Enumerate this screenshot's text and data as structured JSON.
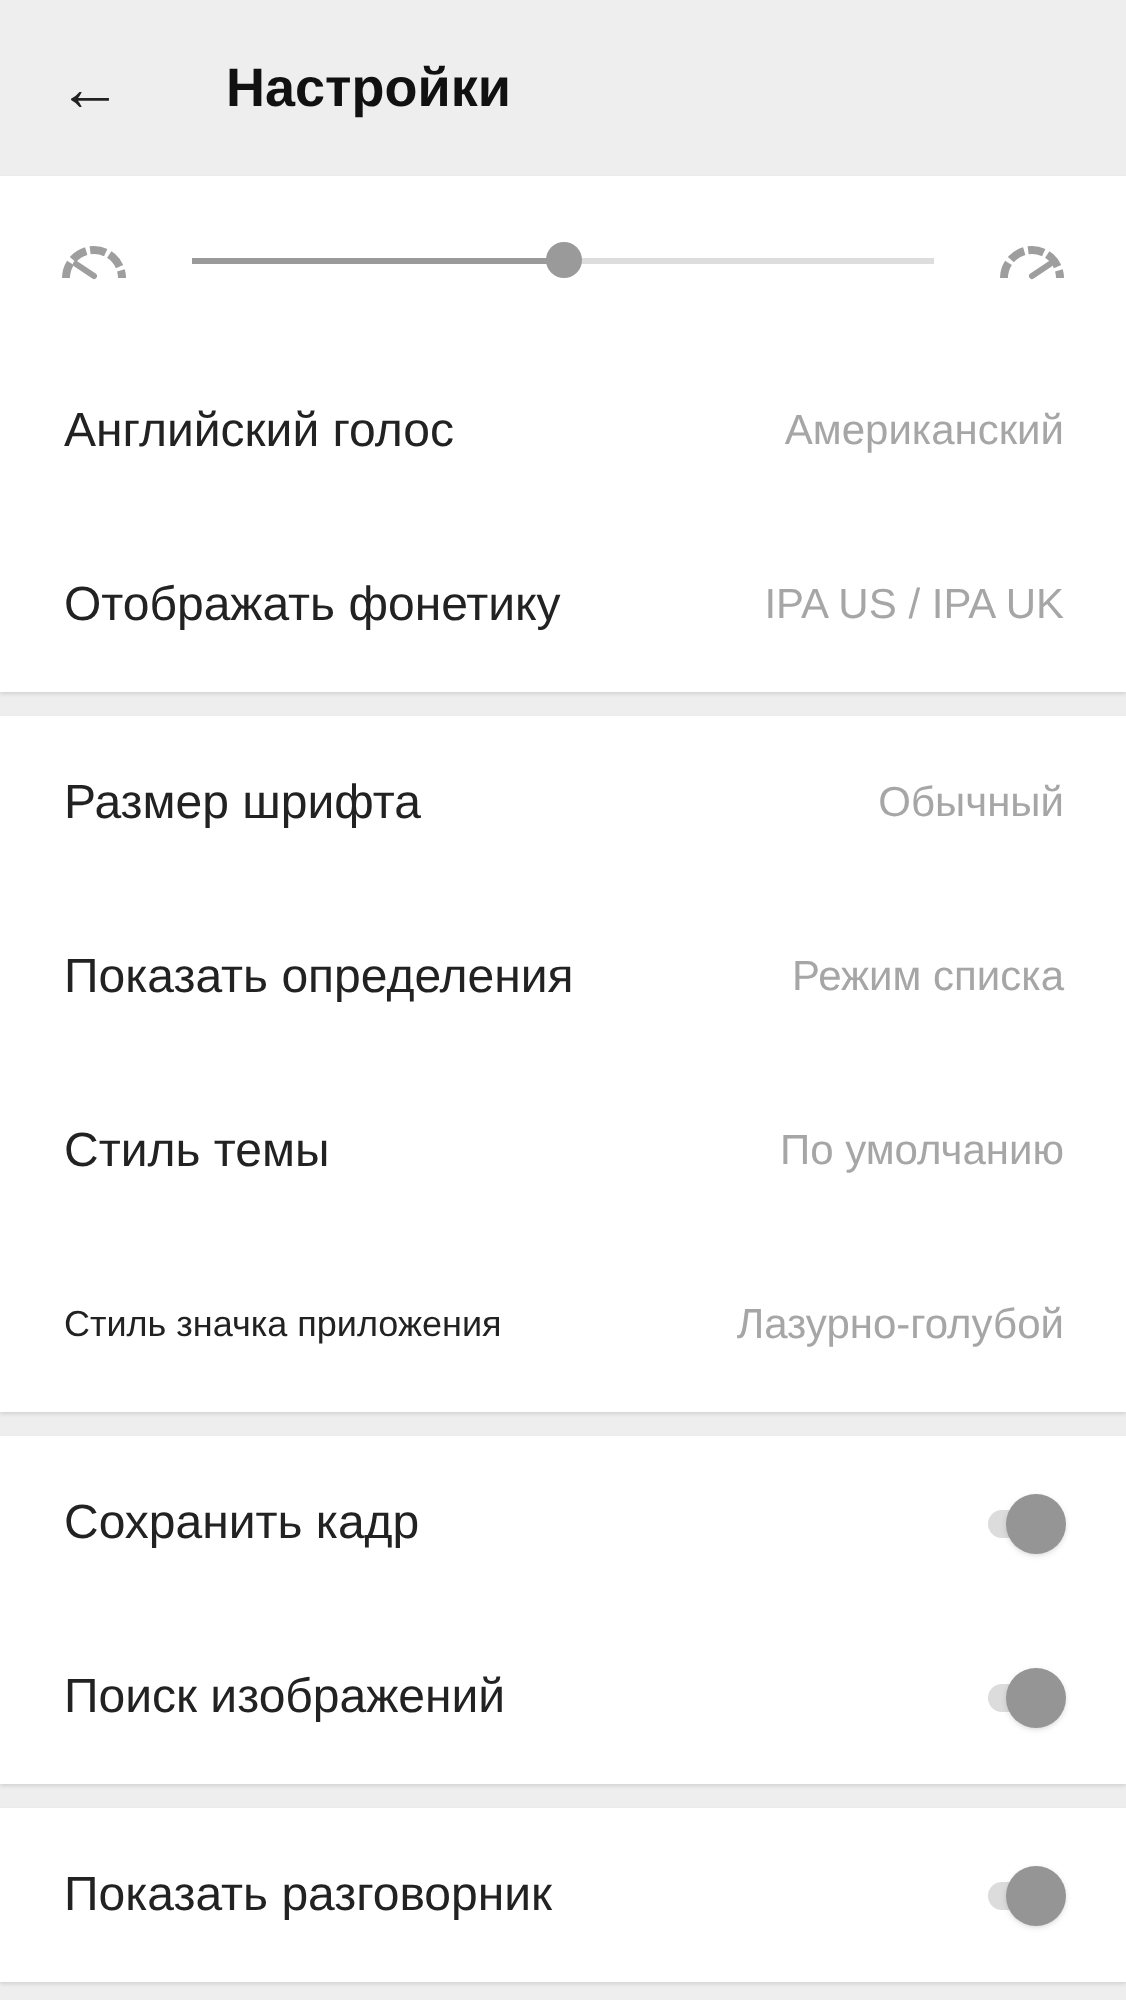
{
  "header": {
    "back": "←",
    "title": "Настройки"
  },
  "sections": [
    [
      {
        "kind": "slider",
        "level": 0.5
      },
      {
        "kind": "value",
        "label": "Английский голос",
        "value": "Американский",
        "small_label": false
      },
      {
        "kind": "value",
        "label": "Отображать фонетику",
        "value": "IPA US / IPA UK",
        "small_label": false
      }
    ],
    [
      {
        "kind": "value",
        "label": "Размер шрифта",
        "value": "Обычный",
        "small_label": false
      },
      {
        "kind": "value",
        "label": "Показать определения",
        "value": "Режим списка",
        "small_label": false
      },
      {
        "kind": "value",
        "label": "Стиль темы",
        "value": "По умолчанию",
        "small_label": false
      },
      {
        "kind": "value",
        "label": "Стиль значка приложения",
        "value": "Лазурно-голубой",
        "small_label": true
      }
    ],
    [
      {
        "kind": "toggle",
        "label": "Сохранить кадр",
        "on": true
      },
      {
        "kind": "toggle",
        "label": "Поиск изображений",
        "on": true
      }
    ],
    [
      {
        "kind": "toggle",
        "label": "Показать разговорник",
        "on": true
      }
    ]
  ]
}
